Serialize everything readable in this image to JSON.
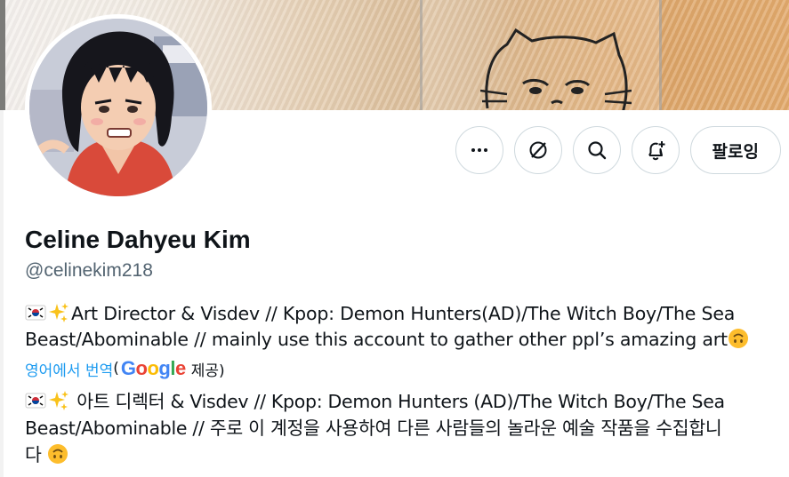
{
  "profile": {
    "name": "Celine Dahyeu Kim",
    "handle": "@celinekim218"
  },
  "actions": {
    "more_icon": "more-icon",
    "grok_icon": "grok-icon",
    "search_icon": "search-icon",
    "notify_icon": "bell-plus-icon",
    "follow_label": "팔로잉"
  },
  "bio": {
    "line1": "Art Director & Visdev // Kpop: Demon Hunters(AD)/The Witch Boy/The Sea",
    "line2": "Beast/Abominable // mainly use this account to gather other ppl’s amazing art"
  },
  "translate": {
    "link": "영어에서 번역",
    "open_paren": "(",
    "provider_suffix": " 제공)",
    "google": "Google"
  },
  "translated_bio": {
    "line1": " 아트 디렉터 & Visdev // Kpop: Demon Hunters (AD)/The Witch Boy/The Sea",
    "line2": "Beast/Abominable // 주로 이 계정을 사용하여 다른 사람들의 놀라운 예술 작품을 수집합니",
    "line3": "다 "
  },
  "colors": {
    "accent": "#1d9bf0",
    "text": "#0f1419",
    "muted": "#536471",
    "border": "#cfd9de"
  }
}
